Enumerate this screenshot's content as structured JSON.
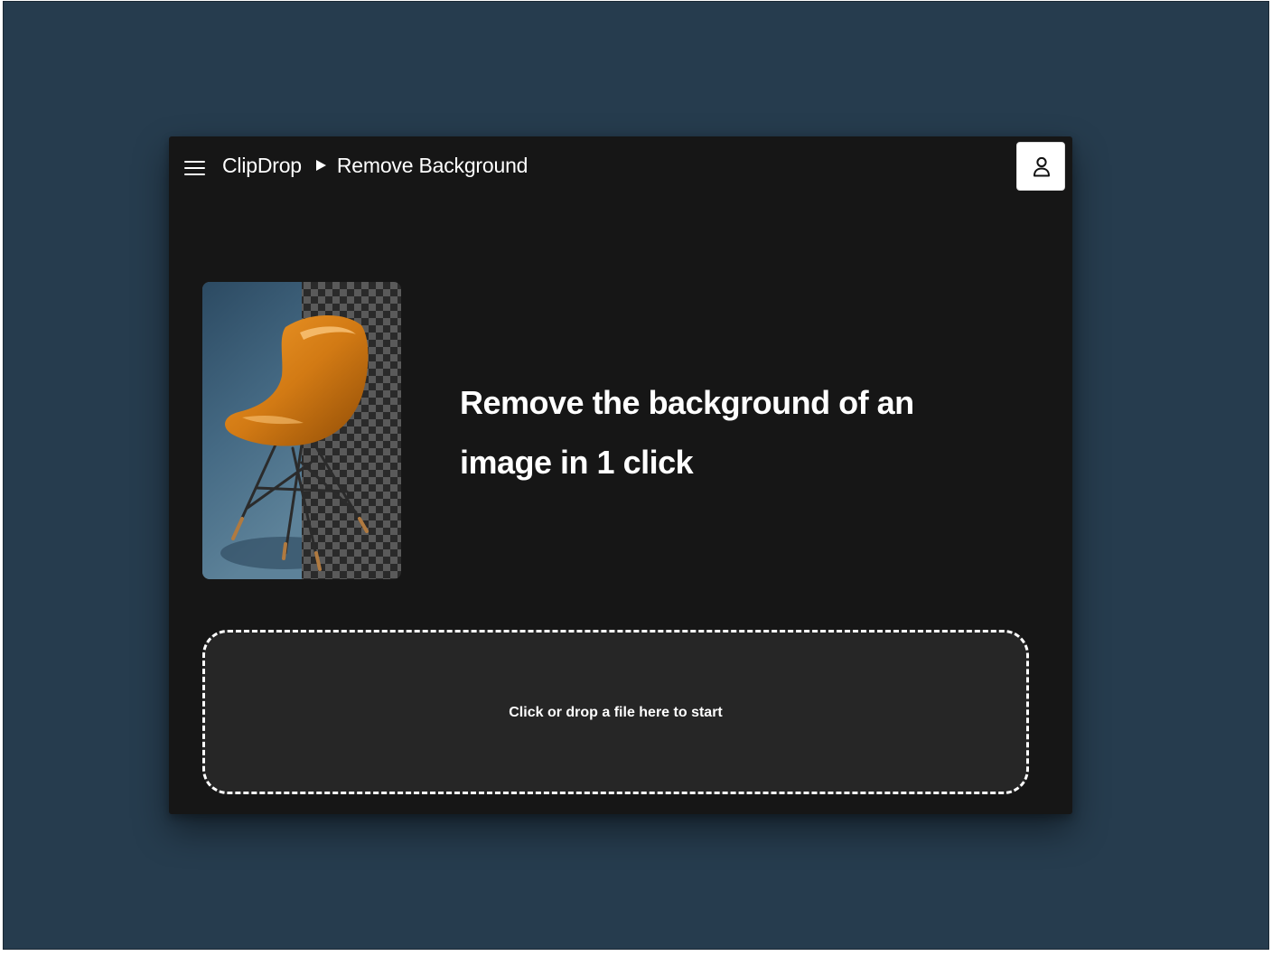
{
  "header": {
    "brand": "ClipDrop",
    "page_title": "Remove Background"
  },
  "hero": {
    "title": "Remove the background of an image in 1 click"
  },
  "dropzone": {
    "label": "Click or drop a file here to start"
  },
  "colors": {
    "desktop_background": "#263c4e",
    "window_background": "#161616",
    "dropzone_background": "#262626",
    "chair_orange": "#d27a14"
  },
  "icons": {
    "menu": "hamburger-menu-icon",
    "breadcrumb_separator": "triangle-right-icon",
    "user": "user-icon"
  }
}
